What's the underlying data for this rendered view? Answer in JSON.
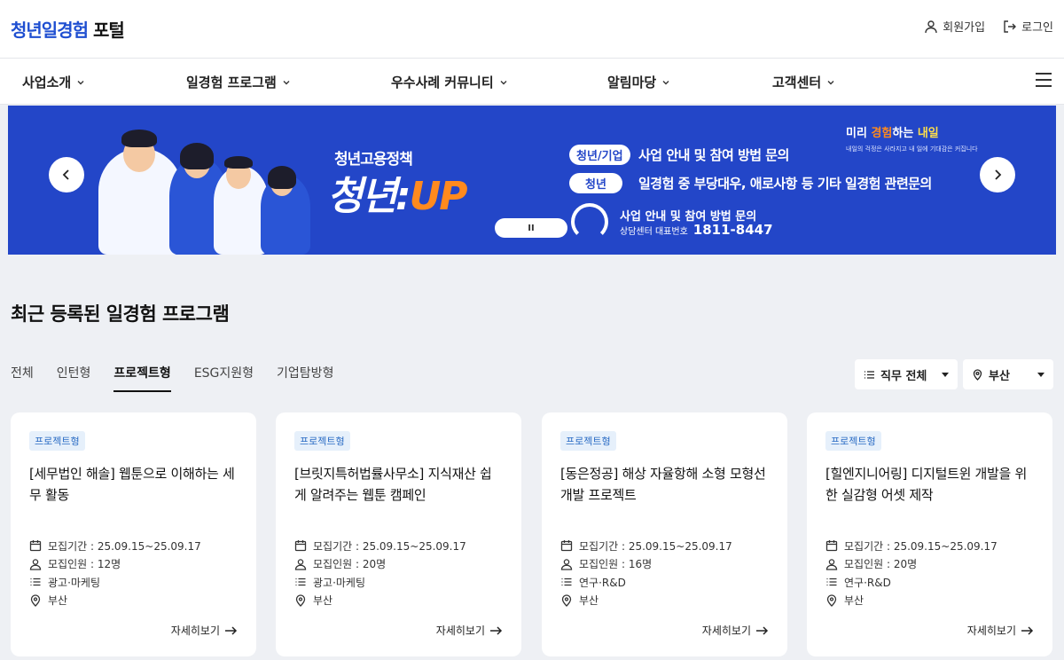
{
  "header": {
    "logo_brand": "청년일경험",
    "logo_suffix": "포털",
    "signup_label": "회원가입",
    "login_label": "로그인"
  },
  "nav": {
    "items": [
      {
        "label": "사업소개"
      },
      {
        "label": "일경험 프로그램"
      },
      {
        "label": "우수사례 커뮤니티"
      },
      {
        "label": "알림마당"
      },
      {
        "label": "고객센터"
      }
    ]
  },
  "banner": {
    "policy_small": "청년고용정책",
    "policy_big_prefix": "청년:",
    "policy_big_up": "UP",
    "row1_tag": "청년/기업",
    "row1_text": "사업 안내 및 참여 방법 문의",
    "row2_tag": "청년",
    "row2_text": "일경험 중 부당대우, 애로사항 등 기타 일경험 관련문의",
    "phone_title": "사업 안내 및 참여 방법 문의",
    "phone_label": "상담센터 대표번호",
    "phone_number": "1811-8447",
    "brand_a": "미리",
    "brand_b": "경험",
    "brand_c": "하는",
    "brand_d": "내일",
    "brand_sub": "내일의 걱정은 사라지고 내 일에 기대감은 커집니다",
    "pause_label": "II"
  },
  "section": {
    "title": "최근 등록된 일경험 프로그램"
  },
  "tabs": [
    {
      "label": "전체",
      "active": false
    },
    {
      "label": "인턴형",
      "active": false
    },
    {
      "label": "프로젝트형",
      "active": true
    },
    {
      "label": "ESG지원형",
      "active": false
    },
    {
      "label": "기업탐방형",
      "active": false
    }
  ],
  "filters": {
    "job_label": "직무 전체",
    "region_label": "부산"
  },
  "cards": [
    {
      "badge": "프로젝트형",
      "title": "[세무법인 해솔] 웹툰으로 이해하는 세무 활동",
      "period": "모집기간 : 25.09.15~25.09.17",
      "headcount": "모집인원 : 12명",
      "category": "광고·마케팅",
      "location": "부산",
      "more": "자세히보기"
    },
    {
      "badge": "프로젝트형",
      "title": "[브릿지특허법률사무소] 지식재산 쉽게 알려주는 웹툰 캠페인",
      "period": "모집기간 : 25.09.15~25.09.17",
      "headcount": "모집인원 : 20명",
      "category": "광고·마케팅",
      "location": "부산",
      "more": "자세히보기"
    },
    {
      "badge": "프로젝트형",
      "title": "[동은정공] 해상 자율항해 소형 모형선 개발 프로젝트",
      "period": "모집기간 : 25.09.15~25.09.17",
      "headcount": "모집인원 : 16명",
      "category": "연구·R&D",
      "location": "부산",
      "more": "자세히보기"
    },
    {
      "badge": "프로젝트형",
      "title": "[힐엔지니어링] 디지털트윈 개발을 위한 실감형 어셋 제작",
      "period": "모집기간 : 25.09.15~25.09.17",
      "headcount": "모집인원 : 20명",
      "category": "연구·R&D",
      "location": "부산",
      "more": "자세히보기"
    }
  ]
}
